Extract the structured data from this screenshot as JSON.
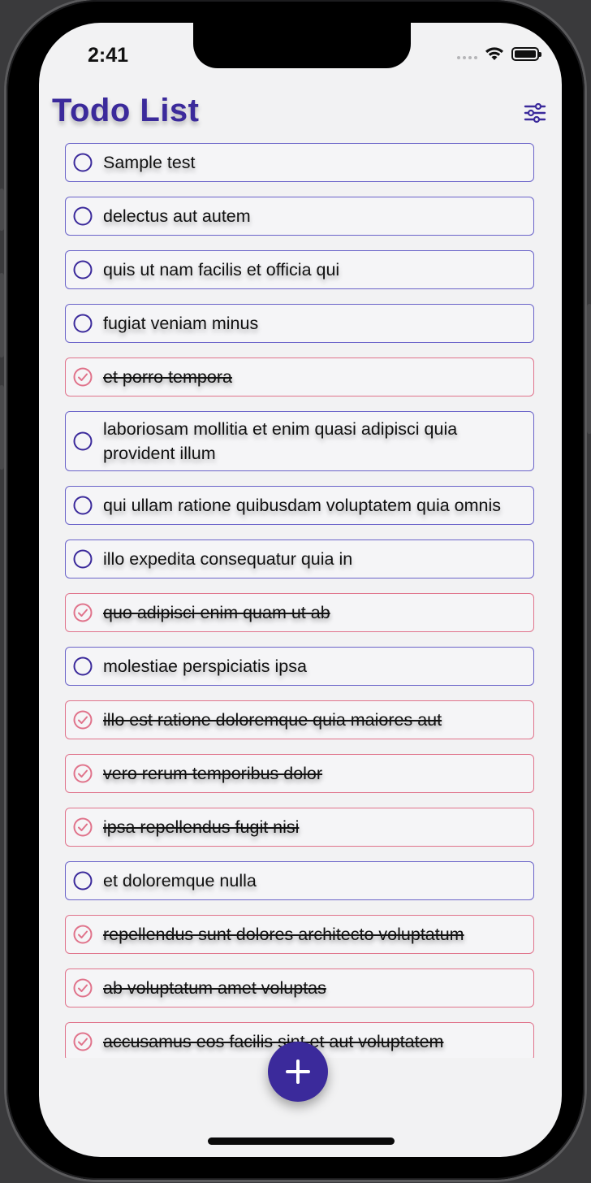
{
  "status_bar": {
    "time": "2:41"
  },
  "header": {
    "title": "Todo List",
    "filter_icon": "sliders-icon"
  },
  "colors": {
    "accent": "#3b2a9b",
    "pending_border": "#6a63c9",
    "done": "#e0738b"
  },
  "todos": [
    {
      "text": "Sample test",
      "completed": false
    },
    {
      "text": "delectus aut autem",
      "completed": false
    },
    {
      "text": "quis ut nam facilis et officia qui",
      "completed": false
    },
    {
      "text": "fugiat veniam minus",
      "completed": false
    },
    {
      "text": "et porro tempora",
      "completed": true
    },
    {
      "text": "laboriosam mollitia et enim quasi adipisci quia provident illum",
      "completed": false
    },
    {
      "text": "qui ullam ratione quibusdam voluptatem quia omnis",
      "completed": false
    },
    {
      "text": "illo expedita consequatur quia in",
      "completed": false
    },
    {
      "text": "quo adipisci enim quam ut ab",
      "completed": true
    },
    {
      "text": "molestiae perspiciatis ipsa",
      "completed": false
    },
    {
      "text": "illo est ratione doloremque quia maiores aut",
      "completed": true
    },
    {
      "text": "vero rerum temporibus dolor",
      "completed": true
    },
    {
      "text": "ipsa repellendus fugit nisi",
      "completed": true
    },
    {
      "text": "et doloremque nulla",
      "completed": false
    },
    {
      "text": "repellendus sunt dolores architecto voluptatum",
      "completed": true
    },
    {
      "text": "ab voluptatum amet voluptas",
      "completed": true
    },
    {
      "text": "accusamus eos facilis sint et aut voluptatem",
      "completed": true
    }
  ],
  "fab": {
    "icon": "plus-icon"
  }
}
